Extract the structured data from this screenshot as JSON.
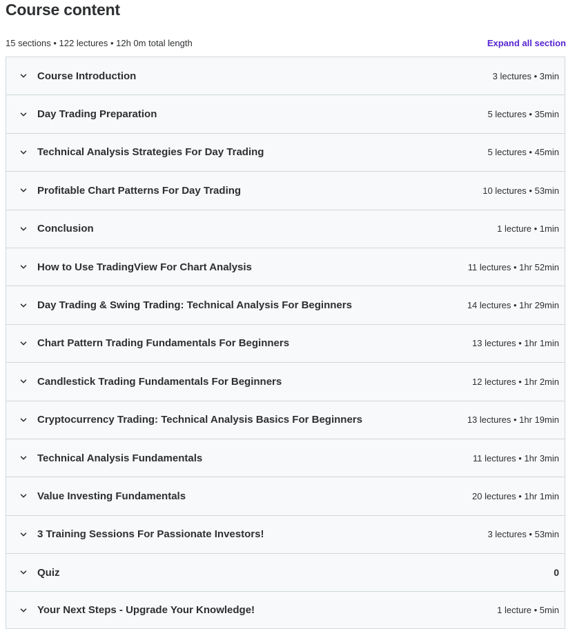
{
  "header": {
    "title": "Course content",
    "summary": "15 sections • 122 lectures • 12h 0m total length",
    "expand_label": "Expand all section"
  },
  "sections": [
    {
      "title": "Course Introduction",
      "info": "3 lectures • 3min"
    },
    {
      "title": "Day Trading Preparation",
      "info": "5 lectures • 35min"
    },
    {
      "title": "Technical Analysis Strategies For Day Trading",
      "info": "5 lectures • 45min"
    },
    {
      "title": "Profitable Chart Patterns For Day Trading",
      "info": "10 lectures • 53min"
    },
    {
      "title": "Conclusion",
      "info": "1 lecture • 1min"
    },
    {
      "title": "How to Use TradingView For Chart Analysis",
      "info": "11 lectures • 1hr 52min"
    },
    {
      "title": "Day Trading & Swing Trading: Technical Analysis For Beginners",
      "info": "14 lectures • 1hr 29min"
    },
    {
      "title": "Chart Pattern Trading Fundamentals For Beginners",
      "info": "13 lectures • 1hr 1min"
    },
    {
      "title": "Candlestick Trading Fundamentals For Beginners",
      "info": "12 lectures • 1hr 2min"
    },
    {
      "title": "Cryptocurrency Trading: Technical Analysis Basics For Beginners",
      "info": "13 lectures • 1hr 19min"
    },
    {
      "title": "Technical Analysis Fundamentals",
      "info": "11 lectures • 1hr 3min"
    },
    {
      "title": "Value Investing Fundamentals",
      "info": "20 lectures • 1hr 1min"
    },
    {
      "title": "3 Training Sessions For Passionate Investors!",
      "info": "3 lectures • 53min"
    },
    {
      "title": "Quiz",
      "info": "0"
    },
    {
      "title": "Your Next Steps - Upgrade Your Knowledge!",
      "info": "1 lecture • 5min"
    }
  ],
  "icons": {
    "section_toggle": "chevron-down-icon"
  }
}
